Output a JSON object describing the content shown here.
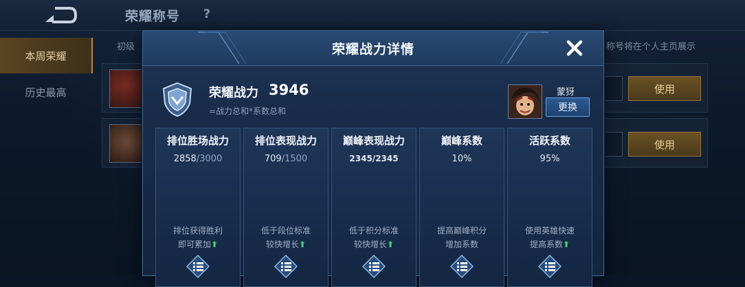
{
  "page": {
    "top_title": "荣耀称号",
    "help_symbol": "?",
    "sidebar": [
      {
        "label": "本周荣耀",
        "active": true
      },
      {
        "label": "历史最高",
        "active": false
      }
    ],
    "background_labels": {
      "level_prefix": "初级",
      "tip_text": "称号将在个人主页展示",
      "use_button": "使用"
    }
  },
  "modal": {
    "title": "荣耀战力详情",
    "summary_label": "荣耀战力",
    "summary_value": "3946",
    "summary_formula": "=战力总和*系数总和",
    "hero_name": "蒙犽",
    "swap_label": "更换",
    "cards": [
      {
        "title": "排位胜场战力",
        "value": "2858",
        "max": "3000",
        "hint1": "排位获得胜利",
        "hint2": "即可累加"
      },
      {
        "title": "排位表现战力",
        "value": "709",
        "max": "1500",
        "hint1": "低于段位标准",
        "hint2": "较快增长"
      },
      {
        "title": "巅峰表现战力",
        "value": "2345/2345",
        "max": "",
        "hint1": "低于积分标准",
        "hint2": "较快增长"
      },
      {
        "title": "巅峰系数",
        "value": "10%",
        "max": "",
        "hint1": "提高巅峰积分",
        "hint2": "增加系数"
      },
      {
        "title": "活跃系数",
        "value": "95%",
        "max": "",
        "hint1": "使用英雄快速",
        "hint2": "提高系数"
      }
    ]
  },
  "colors": {
    "accent_gold": "#b38b45",
    "modal_border": "#3f6a9b",
    "up_arrow_green": "#3fd46a"
  },
  "icons": {
    "back": "back-arrow-icon",
    "close": "close-icon",
    "badge": "shield-badge-icon",
    "detail": "list-detail-icon",
    "up": "up-arrow-icon"
  }
}
